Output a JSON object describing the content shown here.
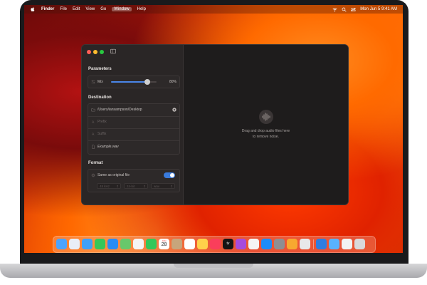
{
  "menubar": {
    "app_name": "Finder",
    "items": [
      "File",
      "Edit",
      "View",
      "Go",
      "Window",
      "Help"
    ],
    "active_item": "Window",
    "clock": "Mon Jun 5  9:41 AM"
  },
  "window": {
    "parameters": {
      "title": "Parameters",
      "mix_label": "Mix",
      "mix_value_text": "80%",
      "mix_fraction": 0.8
    },
    "destination": {
      "title": "Destination",
      "path": "/Users/iansampson/Desktop",
      "prefix_placeholder": "Prefix",
      "suffix_placeholder": "Suffix",
      "example_filename": "Example.wav"
    },
    "format": {
      "title": "Format",
      "same_as_original_label": "Same as original file",
      "same_as_original_on": true,
      "sample_rate": "48 kHz",
      "bit_depth": "24-bit",
      "file_type": "wav"
    },
    "drop_zone": {
      "line1": "Drag and drop audio files here",
      "line2": "to remove noise."
    }
  },
  "dock": {
    "apps": [
      {
        "name": "Finder",
        "color": "#4aa3ff"
      },
      {
        "name": "Launchpad",
        "color": "#e9eef7"
      },
      {
        "name": "Safari",
        "color": "#3fa0f7"
      },
      {
        "name": "Messages",
        "color": "#35c759"
      },
      {
        "name": "Mail",
        "color": "#2a8cf5"
      },
      {
        "name": "Maps",
        "color": "#68c86b"
      },
      {
        "name": "Photos",
        "color": "#f5f5f5"
      },
      {
        "name": "FaceTime",
        "color": "#34c759"
      },
      {
        "name": "Calendar",
        "color": "#ffffff"
      },
      {
        "name": "Contacts",
        "color": "#c7a57b"
      },
      {
        "name": "Reminders",
        "color": "#ffffff"
      },
      {
        "name": "Notes",
        "color": "#ffd24a"
      },
      {
        "name": "Music",
        "color": "#fa3e5b"
      },
      {
        "name": "TV",
        "color": "#141414"
      },
      {
        "name": "Podcasts",
        "color": "#a64bdc"
      },
      {
        "name": "News",
        "color": "#f5f5f5"
      },
      {
        "name": "App Store",
        "color": "#1d8cf8"
      },
      {
        "name": "System Settings",
        "color": "#8e8e93"
      },
      {
        "name": "Pages",
        "color": "#f7a830"
      },
      {
        "name": "Preview",
        "color": "#e8e8ea"
      },
      {
        "name": "Denoise App",
        "color": "#2f7de0"
      },
      {
        "name": "Downloads Folder",
        "color": "#59b2ff"
      },
      {
        "name": "Document",
        "color": "#f2f2f2"
      },
      {
        "name": "Trash",
        "color": "#d9d9db"
      }
    ],
    "calendar_day": "28",
    "calendar_month": "JUN",
    "tv_label": "tv"
  },
  "colors": {
    "accent": "#4a86e8",
    "window_bg": "#1e1c1c",
    "sidebar_bg": "#2a2626"
  }
}
